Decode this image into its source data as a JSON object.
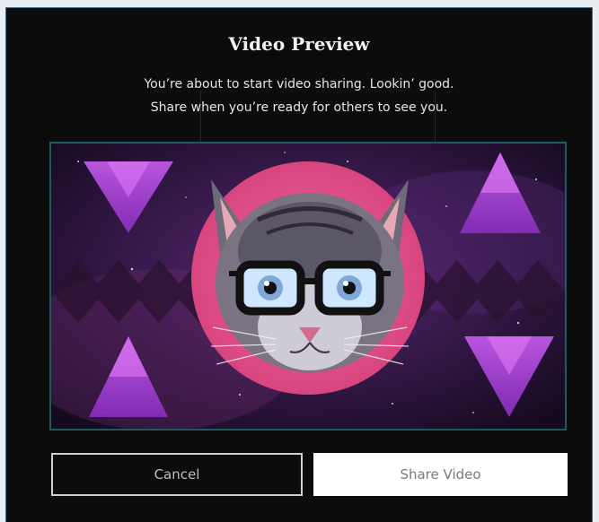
{
  "dialog": {
    "title": "Video Preview",
    "subtitle_line1": "You’re about to start video sharing. Lookin’ good.",
    "subtitle_line2": "Share when you’re ready for others to see you."
  },
  "preview": {
    "image_name": "space-cat-with-glasses",
    "accent_colors": [
      "#e84a8a",
      "#b548e8",
      "#3b1b52"
    ]
  },
  "actions": {
    "cancel_label": "Cancel",
    "share_label": "Share Video"
  },
  "colors": {
    "dialog_background": "#0c0c0c",
    "preview_border": "#1f5a63",
    "share_button_background": "#ffffff"
  }
}
